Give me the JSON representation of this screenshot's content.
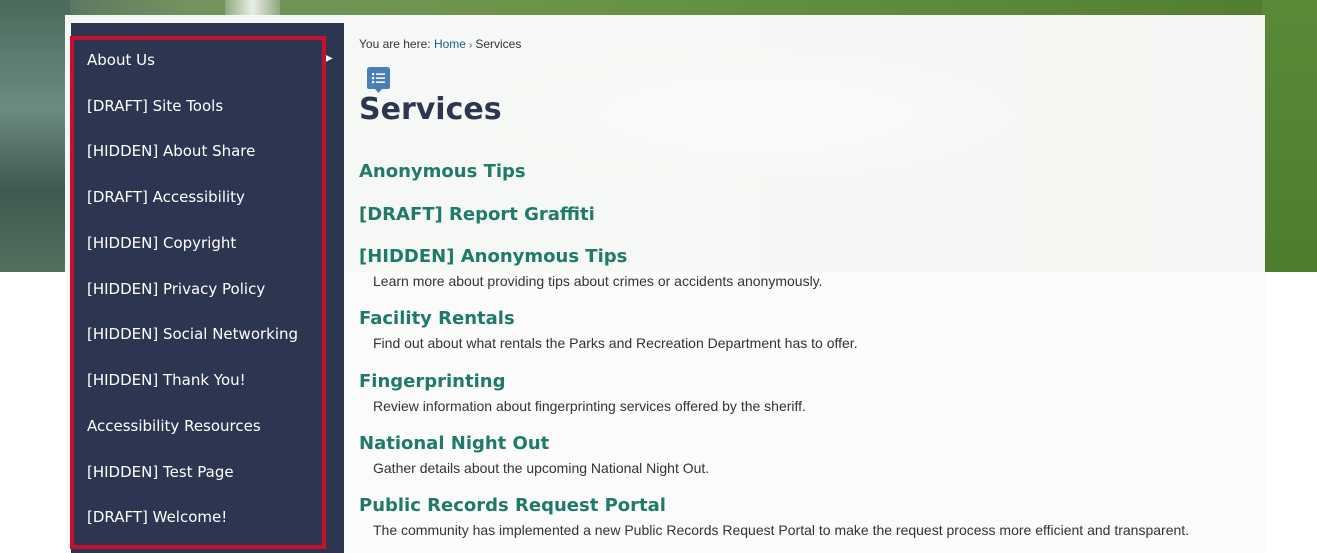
{
  "breadcrumb": {
    "prefix": "You are here:",
    "home": "Home",
    "current": "Services"
  },
  "page": {
    "title": "Services"
  },
  "sidebar": {
    "items": [
      {
        "label": "About Us"
      },
      {
        "label": "[DRAFT] Site Tools"
      },
      {
        "label": "[HIDDEN] About Share"
      },
      {
        "label": "[DRAFT] Accessibility"
      },
      {
        "label": "[HIDDEN] Copyright"
      },
      {
        "label": "[HIDDEN] Privacy Policy"
      },
      {
        "label": "[HIDDEN] Social Networking"
      },
      {
        "label": "[HIDDEN] Thank You!"
      },
      {
        "label": "Accessibility Resources"
      },
      {
        "label": "[HIDDEN] Test Page"
      },
      {
        "label": "[DRAFT] Welcome!"
      }
    ]
  },
  "services": [
    {
      "title": "Anonymous Tips",
      "description": ""
    },
    {
      "title": "[DRAFT] Report Graffiti",
      "description": ""
    },
    {
      "title": "[HIDDEN] Anonymous Tips",
      "description": "Learn more about providing tips about crimes or accidents anonymously."
    },
    {
      "title": "Facility Rentals",
      "description": "Find out about what rentals the Parks and Recreation Department has to offer."
    },
    {
      "title": "Fingerprinting",
      "description": "Review information about fingerprinting services offered by the sheriff."
    },
    {
      "title": "National Night Out",
      "description": "Gather details about the upcoming National Night Out."
    },
    {
      "title": "Public Records Request Portal",
      "description": "The community has implemented a new Public Records Request Portal to make the request process more efficient and transparent."
    }
  ],
  "colors": {
    "sidebar_bg": "#2d3650",
    "highlight_border": "#c8102e",
    "service_link": "#1f7a6a",
    "breadcrumb_link": "#1a5f8a",
    "icon_bg": "#4a7fb5"
  },
  "icons": {
    "page_icon": "list-icon",
    "submenu_arrow": "triangle-right-icon"
  }
}
